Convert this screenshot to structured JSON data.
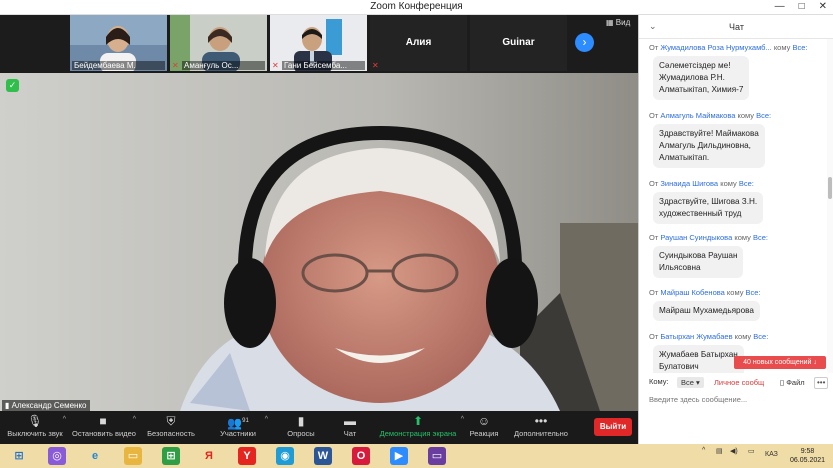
{
  "window": {
    "title": "Zoom Конференция",
    "controls": [
      "—",
      "□",
      "✕"
    ]
  },
  "gallery": {
    "tiles": [
      {
        "name": "Бейдембаева М.",
        "muted": false
      },
      {
        "name": "Аманғуль Ос...",
        "muted": true
      },
      {
        "name": "Гани Бейсемба...",
        "muted": true
      },
      {
        "name": "Алия",
        "muted": true
      },
      {
        "name": "Guinar",
        "muted": false
      }
    ],
    "view_label": "Вид"
  },
  "speaker": {
    "name": "Александр Семенко"
  },
  "toolbar": {
    "items": [
      {
        "label": "Выключить звук",
        "icon": "microphone-icon",
        "glyph": "🎙"
      },
      {
        "label": "Остановить видео",
        "icon": "video-camera-icon",
        "glyph": "■"
      },
      {
        "label": "Безопасность",
        "icon": "shield-icon",
        "glyph": "⛨"
      },
      {
        "label": "Участники",
        "icon": "participants-icon",
        "glyph": "👥",
        "count": "91"
      },
      {
        "label": "Опросы",
        "icon": "polls-icon",
        "glyph": "▮"
      },
      {
        "label": "Чат",
        "icon": "chat-icon",
        "glyph": "▬"
      },
      {
        "label": "Демонстрация экрана",
        "icon": "share-screen-icon",
        "glyph": "⬆"
      },
      {
        "label": "Реакция",
        "icon": "reaction-icon",
        "glyph": "☺"
      },
      {
        "label": "Дополнительно",
        "icon": "more-icon",
        "glyph": "•••"
      }
    ],
    "leave_label": "Выйти"
  },
  "chat": {
    "title": "Чат",
    "messages": [
      {
        "from_prefix": "От",
        "from": "Жумадилова Роза Нурмухамб...",
        "to_prefix": "кому",
        "to": "Все:",
        "text": [
          "Сәлеметсіздер ме!",
          "Жумадилова Р.Н.",
          "Алматыкітап, Химия-7"
        ]
      },
      {
        "from_prefix": "От",
        "from": "Алмагуль Маймакова",
        "to_prefix": "кому",
        "to": "Все:",
        "text": [
          "Здравствуйте! Маймакова",
          "Алмагуль Дильдиновна,",
          "Алматыкітап."
        ]
      },
      {
        "from_prefix": "От",
        "from": "Зинаида Шигова",
        "to_prefix": "кому",
        "to": "Все:",
        "text": [
          "Здраствуйте, Шигова З.Н.",
          "художественный труд"
        ]
      },
      {
        "from_prefix": "От",
        "from": "Раушан Суиндыкова",
        "to_prefix": "кому",
        "to": "Все:",
        "text": [
          "Суиндыкова Раушан",
          "Ильясовна"
        ]
      },
      {
        "from_prefix": "От",
        "from": "Майраш Кобенова",
        "to_prefix": "кому",
        "to": "Все:",
        "text": [
          "Майраш Мухамедьярова"
        ]
      },
      {
        "from_prefix": "От",
        "from": "Батырхан Жумабаев",
        "to_prefix": "кому",
        "to": "Все:",
        "text": [
          "Жумабаев Батырхан",
          "Булатович"
        ]
      }
    ],
    "new_messages_label": "40 новых сообщений ↓",
    "to_label": "Кому:",
    "to_value": "Все ▾",
    "private_label": "Личное сообщ",
    "file_label": "Файл",
    "more_label": "•••",
    "input_placeholder": "Введите здесь сообщение..."
  },
  "taskbar": {
    "lang": "КАЗ",
    "time": "9:58",
    "date": "06.05.2021",
    "apps": [
      {
        "name": "start-icon",
        "glyph": "⊞",
        "color": "#f0dca6",
        "fg": "#1e73c9"
      },
      {
        "name": "alice-icon",
        "glyph": "◎",
        "color": "#8a5bd9",
        "fg": "#fff"
      },
      {
        "name": "ie-icon",
        "glyph": "e",
        "color": "#f0dca6",
        "fg": "#1e88d9"
      },
      {
        "name": "explorer-icon",
        "glyph": "▭",
        "color": "#e8b640",
        "fg": "#fff"
      },
      {
        "name": "store-icon",
        "glyph": "⊞",
        "color": "#2f9e44",
        "fg": "#fff"
      },
      {
        "name": "yandex-icon",
        "glyph": "Я",
        "color": "#f0dca6",
        "fg": "#e52620"
      },
      {
        "name": "yandex-browser-icon",
        "glyph": "Y",
        "color": "#e52620",
        "fg": "#fff"
      },
      {
        "name": "edge-icon",
        "glyph": "◉",
        "color": "#1f9bd6",
        "fg": "#fff"
      },
      {
        "name": "word-icon",
        "glyph": "W",
        "color": "#2b5797",
        "fg": "#fff"
      },
      {
        "name": "opera-icon",
        "glyph": "O",
        "color": "#d81b3c",
        "fg": "#fff"
      },
      {
        "name": "zoom-icon",
        "glyph": "▶",
        "color": "#2d8cff",
        "fg": "#fff"
      },
      {
        "name": "media-icon",
        "glyph": "▭",
        "color": "#6a3ea1",
        "fg": "#fff"
      }
    ]
  }
}
